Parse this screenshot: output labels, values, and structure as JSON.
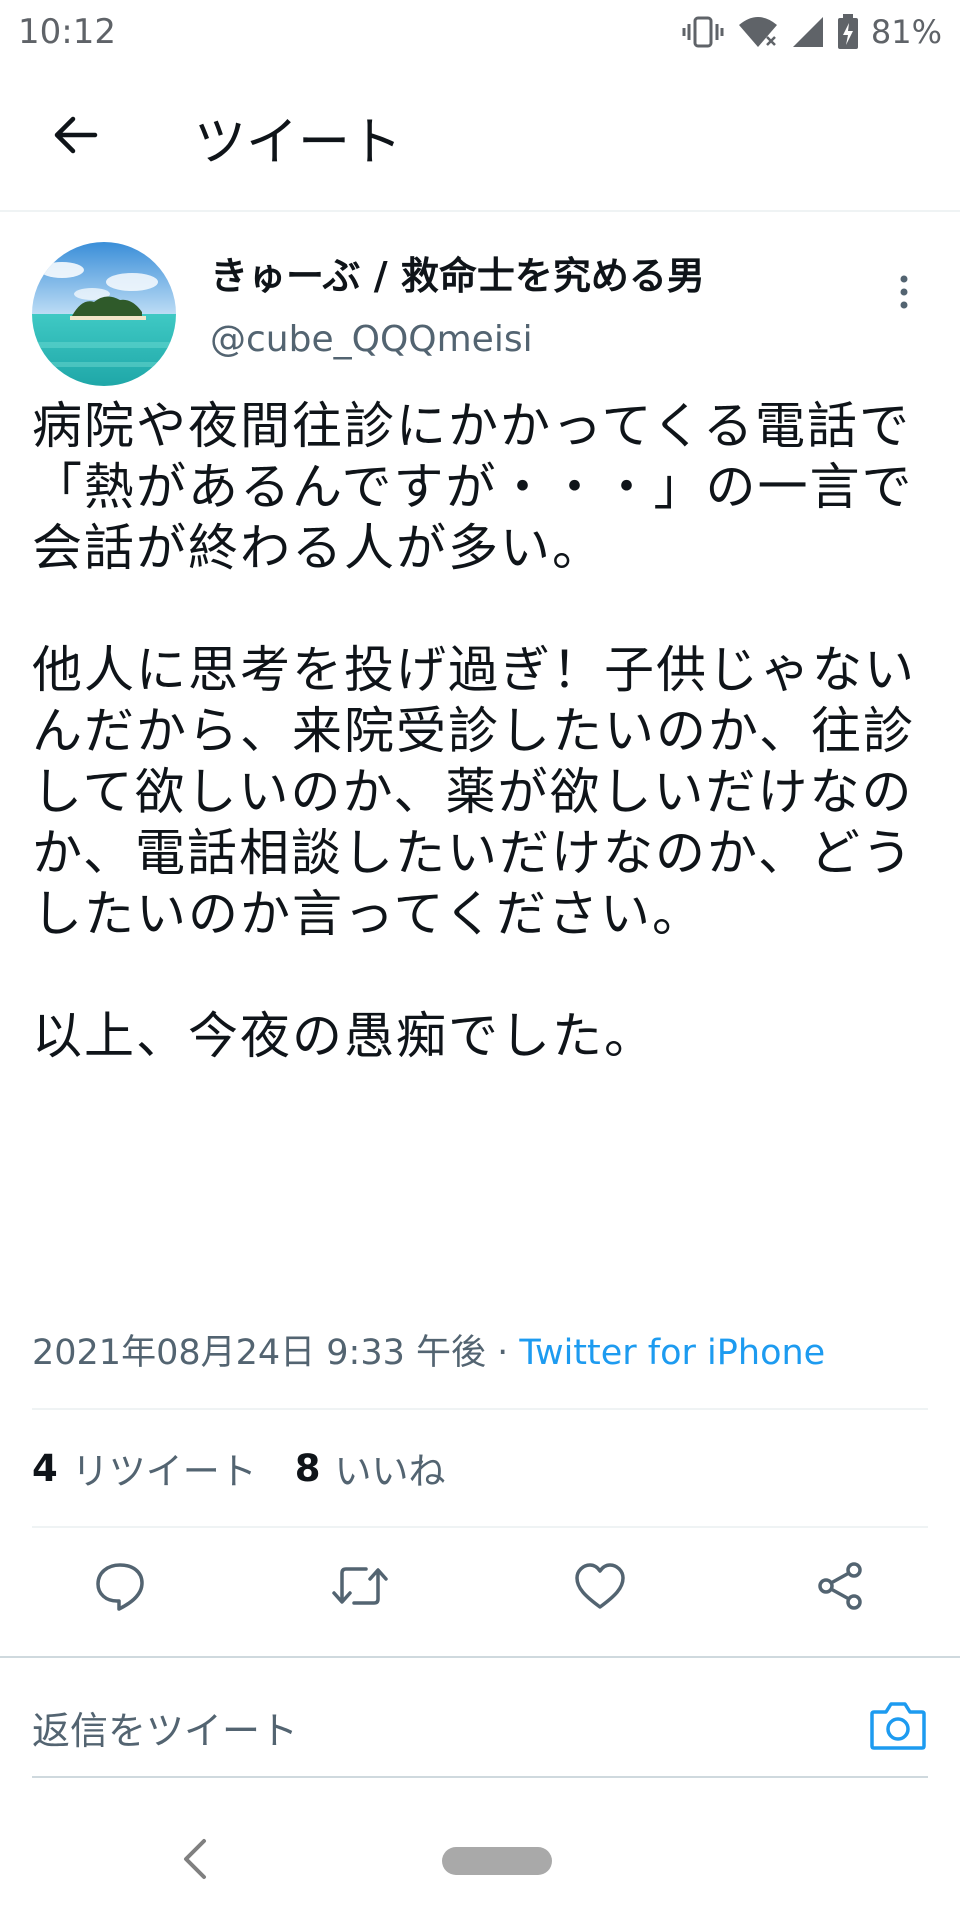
{
  "status_bar": {
    "time": "10:12",
    "battery": "81%",
    "icons": [
      "vibrate-icon",
      "wifi-icon",
      "signal-icon",
      "battery-charging-icon"
    ]
  },
  "header": {
    "title": "ツイート",
    "back_icon": "arrow-left-icon"
  },
  "tweet": {
    "author": {
      "display_name": "きゅーぶ / 救命士を究める男",
      "handle": "@cube_QQQmeisi",
      "avatar": "island-sea-photo"
    },
    "body": "病院や夜間往診にかかってくる電話で「熱があるんですが・・・」の一言で会話が終わる人が多い。\n\n他人に思考を投げ過ぎ！子供じゃないんだから、来院受診したいのか、往診して欲しいのか、薬が欲しいだけなのか、電話相談したいだけなのか、どうしたいのか言ってください。\n\n以上、今夜の愚痴でした。",
    "timestamp": "2021年08月24日 9:33 午後 · ",
    "source": "Twitter for iPhone",
    "stats": {
      "retweets_count": "4",
      "retweets_label": "リツイート",
      "likes_count": "8",
      "likes_label": "いいね"
    },
    "actions": [
      "reply-icon",
      "retweet-icon",
      "like-icon",
      "share-icon"
    ]
  },
  "reply": {
    "placeholder": "返信をツイート",
    "camera_icon": "camera-icon"
  },
  "colors": {
    "accent": "#1d9bf0",
    "text_primary": "#0f1419",
    "text_secondary": "#536471",
    "divider": "#eff3f4"
  }
}
